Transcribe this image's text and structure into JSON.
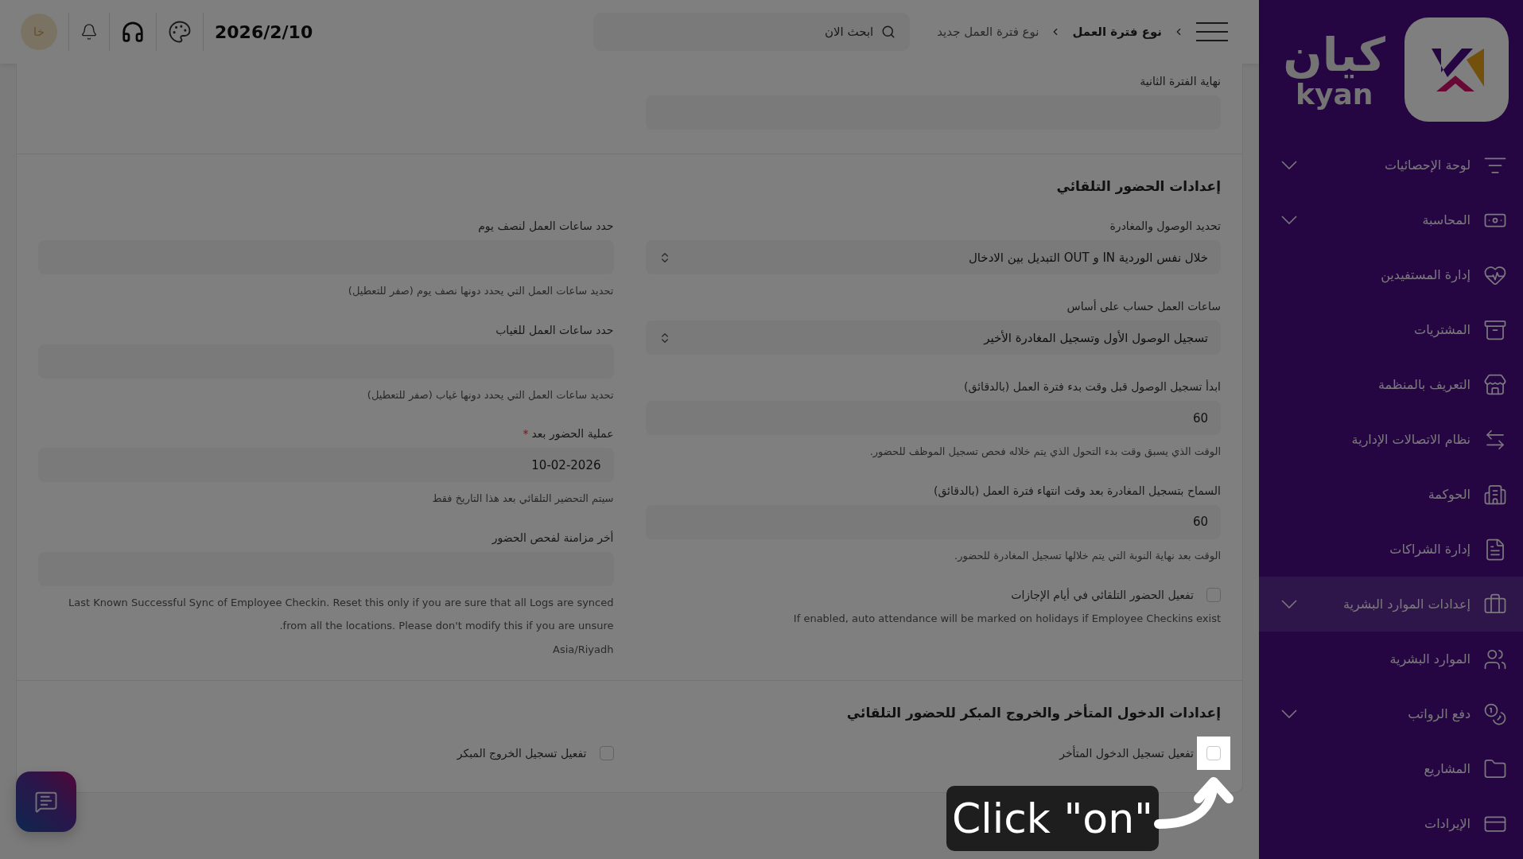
{
  "header": {
    "breadcrumbs": [
      {
        "label": "نوع فترة العمل",
        "current": false
      },
      {
        "label": "نوع فترة العمل جديد",
        "current": true
      }
    ],
    "search": {
      "placeholder": "ابحث الان"
    },
    "date": "2026/2/10",
    "avatar": "خا"
  },
  "sidebar": {
    "logo": {
      "arabic": "كيان",
      "latin": "kyan"
    },
    "items": [
      {
        "label": "لوحة الإحصائيات",
        "expandable": true,
        "selected": false
      },
      {
        "label": "المحاسبة",
        "expandable": true,
        "selected": false
      },
      {
        "label": "إدارة المستفيدين",
        "expandable": false,
        "selected": false
      },
      {
        "label": "المشتريات",
        "expandable": false,
        "selected": false
      },
      {
        "label": "التعريف بالمنظمة",
        "expandable": false,
        "selected": false
      },
      {
        "label": "نظام الاتصالات الإدارية",
        "expandable": false,
        "selected": false
      },
      {
        "label": "الحوكمة",
        "expandable": false,
        "selected": false
      },
      {
        "label": "إدارة الشراكات",
        "expandable": false,
        "selected": false
      },
      {
        "label": "إعدادات الموارد البشرية",
        "expandable": true,
        "selected": true
      },
      {
        "label": "الموارد البشرية",
        "expandable": false,
        "selected": false
      },
      {
        "label": "دفع الرواتب",
        "expandable": true,
        "selected": false
      },
      {
        "label": "المشاريع",
        "expandable": false,
        "selected": false
      },
      {
        "label": "الإيرادات",
        "expandable": false,
        "selected": false
      }
    ]
  },
  "form": {
    "sections": [
      {
        "columns": [
          [
            {
              "kind": "text",
              "label": "نهاية الفترة الثانية"
            }
          ],
          []
        ]
      },
      {
        "title": "إعدادات الحضور التلقائي",
        "columns": [
          [
            {
              "kind": "select",
              "label": "تحديد الوصول والمغادرة",
              "value": "خلال نفس الوردية IN و OUT التبديل بين الادخال"
            },
            {
              "kind": "select",
              "label": "ساعات العمل حساب على أساس",
              "value": "تسجيل الوصول الأول وتسجيل المغادرة الأخير"
            },
            {
              "kind": "text",
              "label": "ابدأ تسجيل الوصول قبل وقت بدء فترة العمل (بالدقائق)",
              "value": "60",
              "help": [
                "الوقت الذي يسبق وقت بدء التحول الذي يتم خلاله فحص تسجيل الموظف للحضور."
              ]
            },
            {
              "kind": "text",
              "label": "السماح بتسجيل المغادرة بعد وقت انتهاء فترة العمل (بالدقائق)",
              "value": "60",
              "help": [
                "الوقت بعد نهاية النوبة التي يتم خلالها تسجيل المغادرة للحضور."
              ]
            },
            {
              "kind": "checkbox",
              "label": "تفعيل الحضور التلقائي في أيام الإجازات",
              "checked": false,
              "highlighted": false,
              "help": [
                "If enabled, auto attendance will be marked on holidays if Employee Checkins exist"
              ]
            }
          ],
          [
            {
              "kind": "text",
              "label": "حدد ساعات العمل لنصف يوم",
              "help": [
                "تحديد ساعات العمل التي يحدد دونها نصف يوم (صفر للتعطيل)"
              ]
            },
            {
              "kind": "text",
              "label": "حدد ساعات العمل للغياب",
              "help": [
                "تحديد ساعات العمل التي يحدد دونها غياب (صفر للتعطيل)"
              ]
            },
            {
              "kind": "text",
              "label": "عملية الحضور بعد",
              "required_mark": "*",
              "value": "10-02-2026",
              "help": [
                "سيتم التحضير التلقائي بعد هذا التاريخ فقط"
              ]
            },
            {
              "kind": "text",
              "label": "أخر مزامنة لفحص الحضور",
              "help": [
                "Last Known Successful Sync of Employee Checkin. Reset this only if you are sure that all Logs are synced",
                "from all the locations. Please don't modify this if you are unsure.",
                "Asia/Riyadh"
              ]
            }
          ]
        ]
      },
      {
        "title": "إعدادات الدخول المتأخر والخروج المبكر للحضور التلقائي",
        "columns": [
          [
            {
              "kind": "checkbox",
              "label": "تفعيل تسجيل الدخول المتأخر",
              "checked": false,
              "highlighted": true
            }
          ],
          [
            {
              "kind": "checkbox",
              "label": "تفعيل تسجيل الخروج المبكر",
              "checked": false,
              "highlighted": false
            }
          ]
        ]
      }
    ]
  },
  "tutorial": {
    "callout": "Click \"on\""
  }
}
